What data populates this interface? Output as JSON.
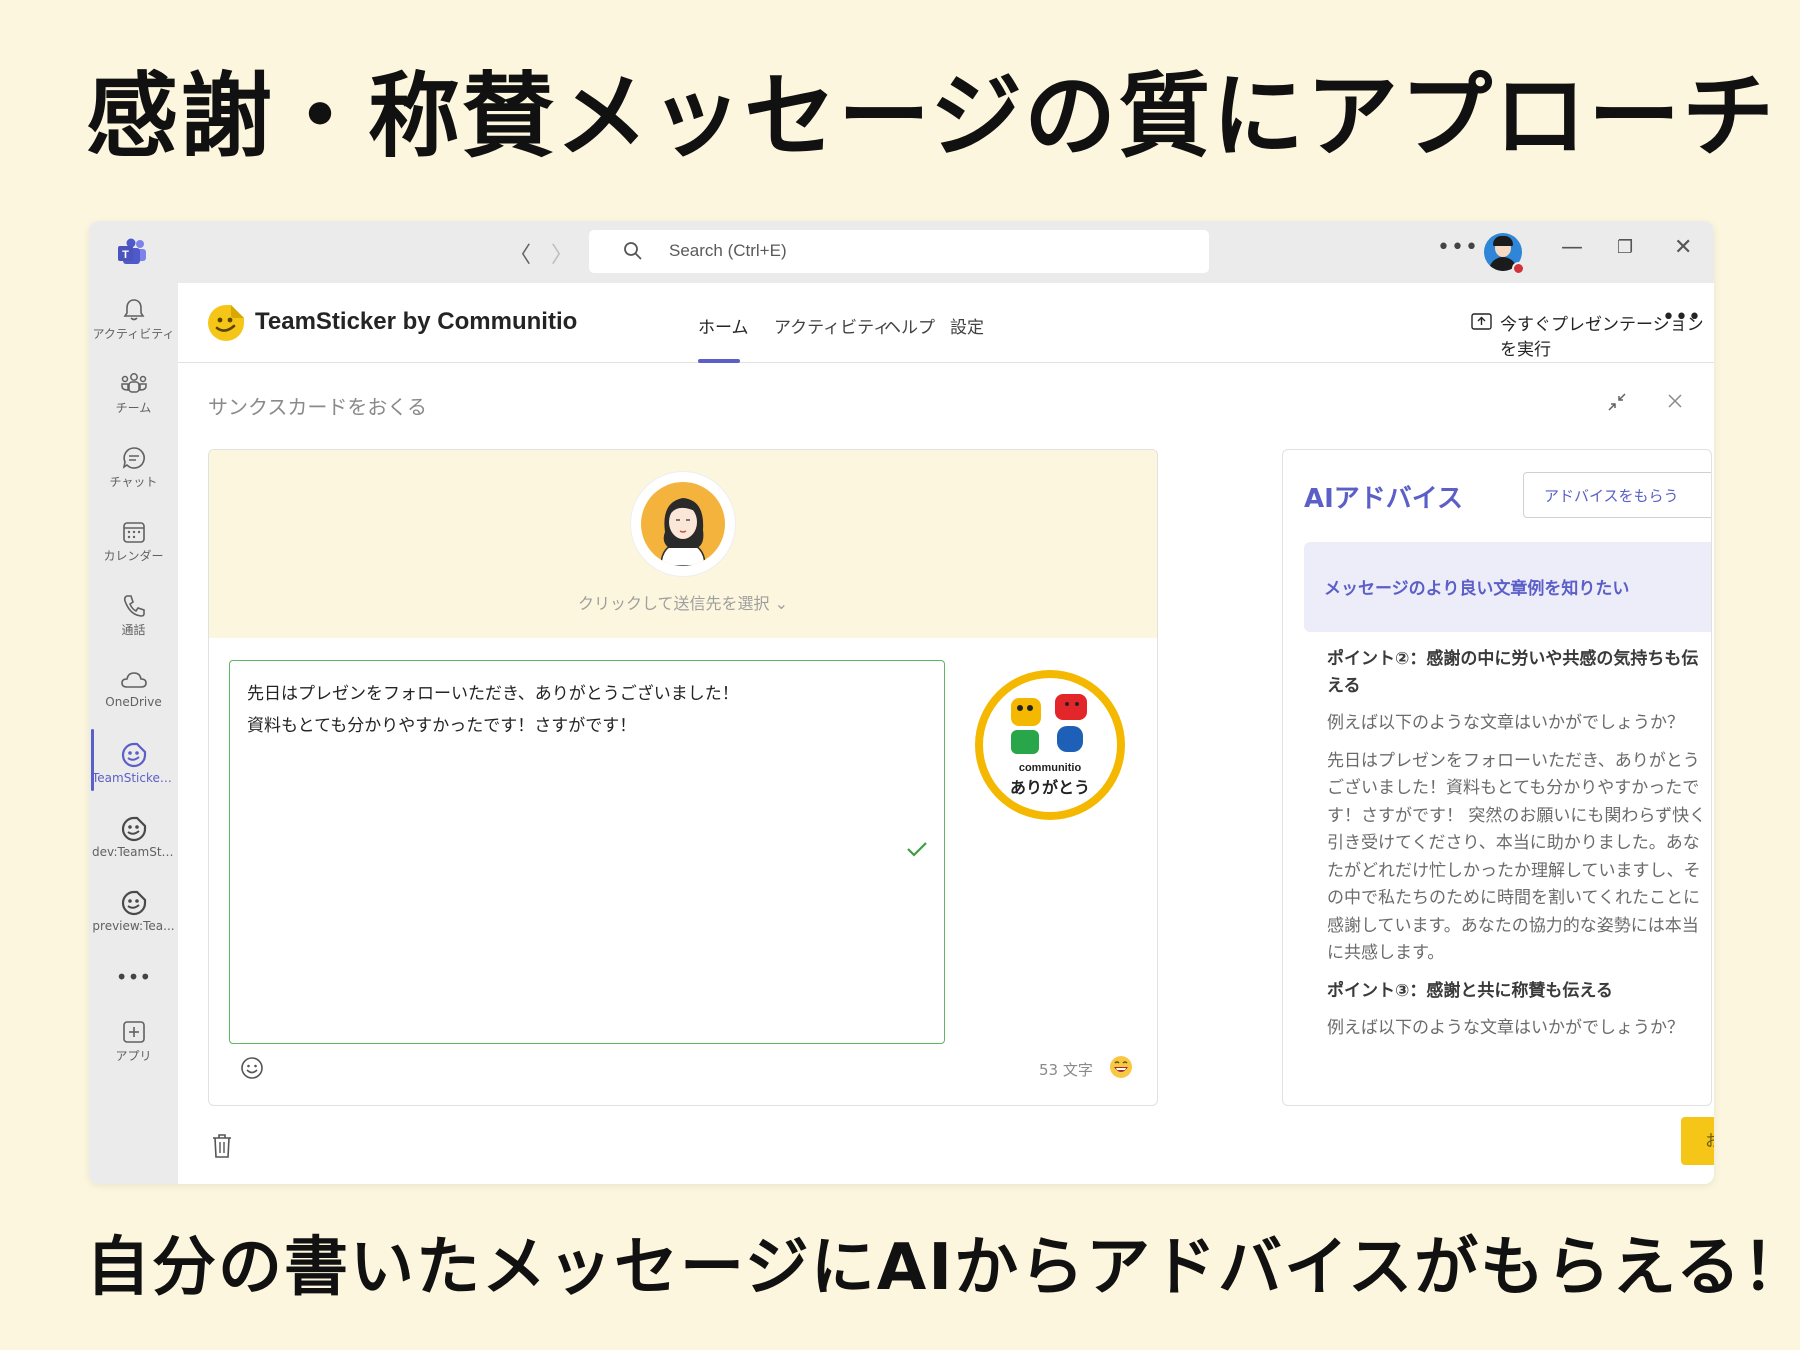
{
  "headline": "感謝・称賛メッセージの質にアプローチ",
  "footline": "自分の書いたメッセージにAIからアドバイスがもらえる！",
  "titlebar": {
    "search_placeholder": "Search (Ctrl+E)",
    "more": "•••",
    "back": "〈",
    "forward": "〉",
    "minimize": "—",
    "restore": "❐",
    "close": "✕"
  },
  "rail": {
    "items": [
      {
        "label": "アクティビティ",
        "icon": "bell-icon"
      },
      {
        "label": "チーム",
        "icon": "teams-icon"
      },
      {
        "label": "チャット",
        "icon": "chat-icon"
      },
      {
        "label": "カレンダー",
        "icon": "calendar-icon"
      },
      {
        "label": "通話",
        "icon": "phone-icon"
      },
      {
        "label": "OneDrive",
        "icon": "cloud-icon"
      },
      {
        "label": "TeamSticker...",
        "icon": "sticker-app-icon"
      },
      {
        "label": "dev:TeamSti...",
        "icon": "sticker-app-icon"
      },
      {
        "label": "preview:Tea...",
        "icon": "sticker-app-icon"
      },
      {
        "label": "•••",
        "icon": "more-icon"
      },
      {
        "label": "アプリ",
        "icon": "add-app-icon"
      }
    ]
  },
  "app": {
    "title": "TeamSticker by Communitio",
    "tabs": [
      "ホーム",
      "アクティビティ",
      "ヘルプ",
      "設定"
    ],
    "present_label": "今すぐプレゼンテーションを実行",
    "more": "•••"
  },
  "card": {
    "title": "サンクスカードをおくる",
    "recipient_label": "クリックして送信先を選択 ⌄",
    "message_lines": [
      "先日はプレゼンをフォローいただき、ありがとうございました！",
      "資料もとても分かりやすかったです！さすがです！"
    ],
    "char_count": "53 文字",
    "sticker_word": "communitio",
    "sticker_text": "ありがとう"
  },
  "ai": {
    "title": "AIアドバイス",
    "select_label": "アドバイスをもらう",
    "tip": "メッセージのより良い文章例を知りたい",
    "point2_heading": [
      "ポイント②：感謝の中に労いや共感の気持ちも伝",
      "える"
    ],
    "point2_intro": "例えば以下のような文章はいかがでしょうか？",
    "point2_example": [
      "先日はプレゼンをフォローいただき、ありがとう",
      "ございました！資料もとても分かりやすかったで",
      "す！さすがです！ 突然のお願いにも関わらず快く",
      "引き受けてくださり、本当に助かりました。あな",
      "たがどれだけ忙しかったか理解していますし、そ",
      "の中で私たちのために時間を割いてくれたことに",
      "感謝しています。あなたの協力的な姿勢には本当",
      "に共感します。"
    ],
    "point3_heading": "ポイント③：感謝と共に称賛も伝える",
    "point3_intro": "例えば以下のような文章はいかがでしょうか？"
  },
  "send_label": "おくる",
  "colors": {
    "page_bg": "#fdf6de",
    "accent": "#5b5fc7",
    "send": "#f5c518",
    "focus_border": "#5fb760"
  }
}
